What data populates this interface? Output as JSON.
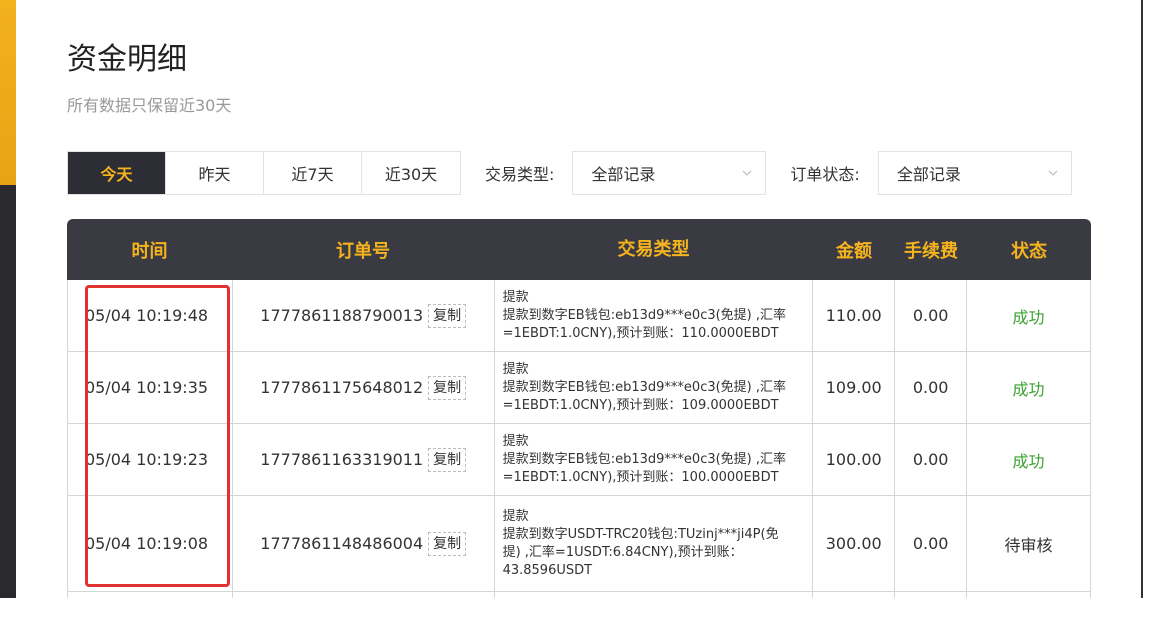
{
  "page": {
    "title": "资金明细",
    "subtitle": "所有数据只保留近30天"
  },
  "filters": {
    "tabs": [
      {
        "label": "今天",
        "active": true
      },
      {
        "label": "昨天",
        "active": false
      },
      {
        "label": "近7天",
        "active": false
      },
      {
        "label": "近30天",
        "active": false
      }
    ],
    "type_label": "交易类型:",
    "type_value": "全部记录",
    "status_label": "订单状态:",
    "status_value": "全部记录"
  },
  "table": {
    "headers": {
      "time": "时间",
      "order": "订单号",
      "type": "交易类型",
      "amount": "金额",
      "fee": "手续费",
      "status": "状态"
    },
    "copy_label": "复制",
    "rows": [
      {
        "time": "05/04 10:19:48",
        "order": "1777861188790013",
        "type_title": "提款",
        "type_l1": "提款到数字EB钱包:eb13d9***e0c3(免提) ,汇率",
        "type_l2": "=1EBDT:1.0CNY),预计到账：110.0000EBDT",
        "type_l3": "",
        "amount": "110.00",
        "fee": "0.00",
        "status": "成功"
      },
      {
        "time": "05/04 10:19:35",
        "order": "1777861175648012",
        "type_title": "提款",
        "type_l1": "提款到数字EB钱包:eb13d9***e0c3(免提) ,汇率",
        "type_l2": "=1EBDT:1.0CNY),预计到账：109.0000EBDT",
        "type_l3": "",
        "amount": "109.00",
        "fee": "0.00",
        "status": "成功"
      },
      {
        "time": "05/04 10:19:23",
        "order": "1777861163319011",
        "type_title": "提款",
        "type_l1": "提款到数字EB钱包:eb13d9***e0c3(免提) ,汇率",
        "type_l2": "=1EBDT:1.0CNY),预计到账：100.0000EBDT",
        "type_l3": "",
        "amount": "100.00",
        "fee": "0.00",
        "status": "成功"
      },
      {
        "time": "05/04 10:19:08",
        "order": "1777861148486004",
        "type_title": "提款",
        "type_l1": "提款到数字USDT-TRC20钱包:TUzinj***ji4P(免",
        "type_l2": "提) ,汇率=1USDT:6.84CNY),预计到账：",
        "type_l3": "43.8596USDT",
        "amount": "300.00",
        "fee": "0.00",
        "status": "待审核"
      }
    ]
  },
  "colors": {
    "accent": "#f5b41e",
    "header_bg": "#3a3a42",
    "success": "#3aa232",
    "highlight": "#e23131"
  }
}
